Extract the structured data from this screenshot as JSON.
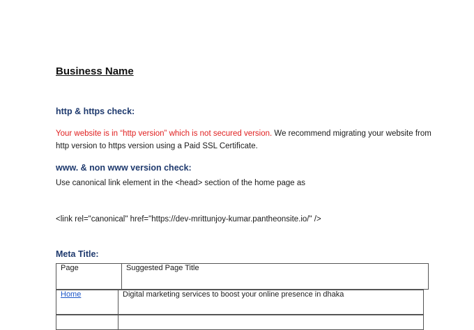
{
  "document": {
    "title": "Business Name",
    "sections": [
      {
        "heading": "http & https check:",
        "paragraph_red": "Your website is in “http version” which is not secured version.",
        "paragraph_rest": " We recommend migrating your website from http version to https version using a Paid SSL Certificate."
      },
      {
        "heading": "www. & non www version check:",
        "paragraph": "Use canonical link element in the <head> section of the home page as",
        "code": "<link rel=\"canonical\" href=\"https://dev-mrittunjoy-kumar.pantheonsite.io/\" />"
      },
      {
        "heading": "Meta Title:"
      }
    ],
    "meta_table": {
      "headers": [
        "Page",
        "Suggested Page Title"
      ],
      "rows": [
        [
          "Home",
          "Digital marketing services to boost your online presence in dhaka"
        ]
      ]
    }
  },
  "colors": {
    "heading": "#1f3a6e",
    "warning_text": "#e02020",
    "link": "#1a55c8"
  }
}
